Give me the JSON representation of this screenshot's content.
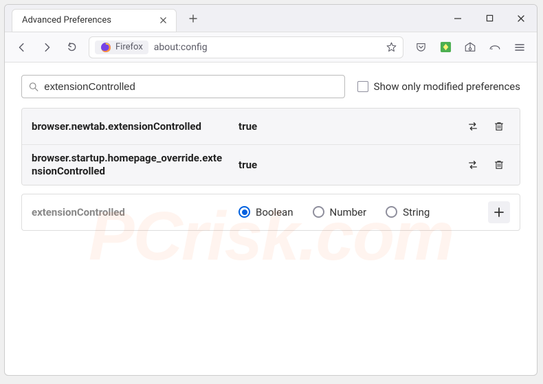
{
  "tab": {
    "title": "Advanced Preferences"
  },
  "urlbar": {
    "chip_label": "Firefox",
    "url": "about:config"
  },
  "search": {
    "value": "extensionControlled"
  },
  "show_only_modified_label": "Show only modified preferences",
  "prefs": [
    {
      "name": "browser.newtab.extensionControlled",
      "value": "true"
    },
    {
      "name": "browser.startup.homepage_override.extensionControlled",
      "value": "true"
    }
  ],
  "newpref": {
    "name": "extensionControlled",
    "types": [
      "Boolean",
      "Number",
      "String"
    ],
    "selected": "Boolean"
  },
  "watermark": "PCrisk.com"
}
